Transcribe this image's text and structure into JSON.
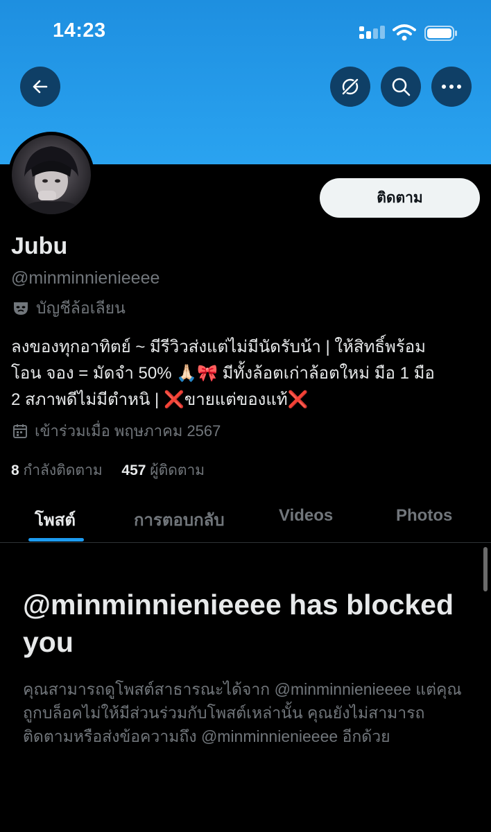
{
  "status_bar": {
    "time": "14:23"
  },
  "profile": {
    "follow_label": "ติดตาม",
    "name": "Jubu",
    "handle": "@minminnienieeee",
    "parody_label": "บัญชีล้อเลียน",
    "bio_line1": "ลงของทุกอาทิตย์ ~ มีรีวิวส่งแต่ไม่มีนัดรับน้า | ให้สิทธิ์พร้อม",
    "bio_line2": "โอน จอง = มัดจำ 50% 🙏🏻🎀 มีทั้งล้อตเก่าล้อตใหม่ มือ 1 มือ",
    "bio_line3": "2 สภาพดีไม่มีตำหนิ | ❌ขายแต่ของแท้❌",
    "joined": "เข้าร่วมเมื่อ พฤษภาคม 2567",
    "following_count": "8",
    "following_label": "กำลังติดตาม",
    "followers_count": "457",
    "followers_label": "ผู้ติดตาม"
  },
  "tabs": [
    {
      "label": "โพสต์",
      "active": true
    },
    {
      "label": "การตอบกลับ",
      "active": false
    },
    {
      "label": "Videos",
      "active": false
    },
    {
      "label": "Photos",
      "active": false
    }
  ],
  "blocked": {
    "title": "@minminnienieeee has blocked you",
    "description": "คุณสามารถดูโพสต์สาธารณะได้จาก @minminnienieeee แต่คุณถูกบล็อคไม่ให้มีส่วนร่วมกับโพสต์เหล่านั้น คุณยังไม่สามารถติดตามหรือส่งข้อความถึง @minminnienieeee อีกด้วย"
  },
  "colors": {
    "header_blue": "#1d9bf0",
    "follow_bg": "#eff3f4",
    "muted": "#71767b",
    "accent": "#1d9bf0"
  },
  "icons": [
    "back-arrow-icon",
    "grok-icon",
    "search-icon",
    "more-icon",
    "parody-mask-icon",
    "calendar-icon",
    "signal-icon",
    "wifi-icon",
    "battery-icon"
  ]
}
